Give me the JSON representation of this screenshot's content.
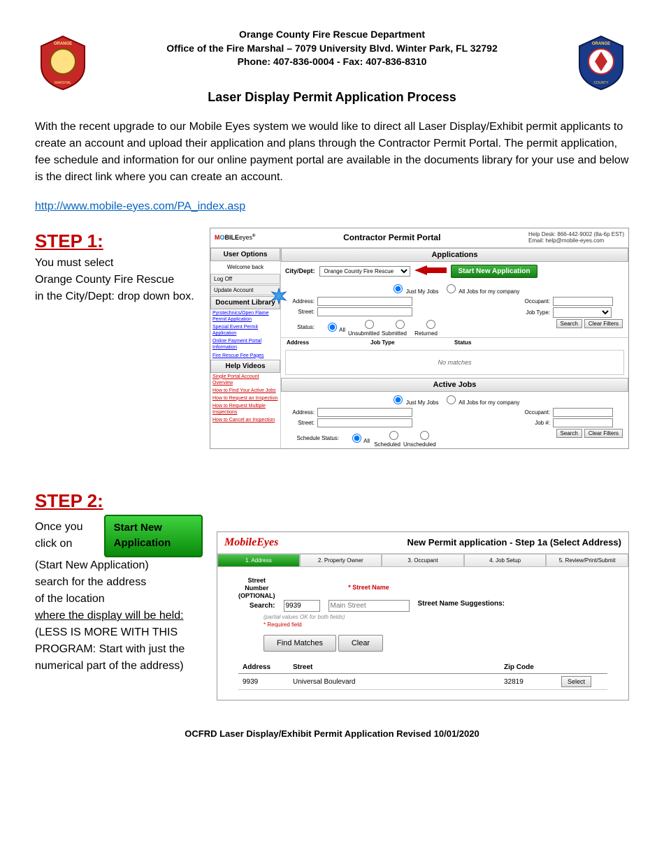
{
  "header": {
    "l1": "Orange County Fire Rescue Department",
    "l2": "Office of the Fire Marshal – 7079 University Blvd. Winter Park, FL 32792",
    "l3": "Phone:  407-836-0004 - Fax: 407-836-8310"
  },
  "title": "Laser Display Permit Application Process",
  "intro": "With the recent upgrade to our Mobile Eyes system we would like to direct all Laser Display/Exhibit permit applicants to create an account and upload their application and plans through the Contractor Permit Portal. The permit application, fee schedule and information for our online payment portal are available in the documents library for your use and below is the direct link where you can create an account.",
  "link": "http://www.mobile-eyes.com/PA_index.asp",
  "step1": {
    "heading": "STEP 1:",
    "l1": "You must select",
    "l2": "Orange County Fire Rescue",
    "l3": "in the City/Dept: drop down box."
  },
  "shot1": {
    "logo": "MOBILEeyes",
    "portal_title": "Contractor Permit Portal",
    "help_l1": "Help Desk: 866-442-9002 (8a-6p EST)",
    "help_l2": "Email: help@mobile-eyes.com",
    "sidebar": {
      "user_options": "User Options",
      "welcome": "Welcome back",
      "logoff": "Log Off",
      "update": "Update Account",
      "doc_lib": "Document Library",
      "docs": [
        "Pyrotechnics/Open Flame Permit Application",
        "Special Event Permit Application",
        "Online Payment Portal Information",
        "Fire Rescue Fee Pages"
      ],
      "help_videos": "Help Videos",
      "videos": [
        "Single Portal Account Overview",
        "How to Find Your Active Jobs",
        "How to Request an Inspection",
        "How to Request Multiple Inspections",
        "How to Cancel an Inspection"
      ]
    },
    "applications": {
      "hdr": "Applications",
      "city_label": "City/Dept:",
      "city_value": "Orange County Fire Rescue",
      "start_btn": "Start New Application",
      "just_my": "Just My Jobs",
      "all_jobs": "All Jobs for my company",
      "address": "Address:",
      "street": "Street:",
      "status": "Status:",
      "all": "All",
      "unsub": "Unsubmitted",
      "sub": "Submitted",
      "ret": "Returned",
      "occupant": "Occupant:",
      "jobtype": "Job Type:",
      "search": "Search",
      "clear": "Clear Filters",
      "th_addr": "Address",
      "th_jt": "Job Type",
      "th_status": "Status",
      "nomatch": "No matches"
    },
    "active": {
      "hdr": "Active Jobs",
      "just_my": "Just My Jobs",
      "all_jobs": "All Jobs for my company",
      "address": "Address:",
      "street": "Street:",
      "sched": "Schedule Status:",
      "all": "All",
      "scheduled": "Scheduled",
      "unscheduled": "Unscheduled",
      "occupant": "Occupant:",
      "jobid": "Job #:",
      "search": "Search",
      "clear": "Clear Filters"
    }
  },
  "step2": {
    "heading": "STEP 2:",
    "btn": "Start New Application",
    "l1": "Once you click on",
    "l2": "(Start New Application)",
    "l3": "search for the address",
    "l4": "of the location",
    "l5": "where the display will be held:",
    "l6": "(LESS IS MORE WITH THIS",
    "l7": "PROGRAM: Start with just the",
    "l8": "numerical part of the address)"
  },
  "shot2": {
    "logo": "MobileEyes",
    "title": "New Permit application - Step 1a (Select Address)",
    "tabs": [
      "1. Address",
      "2. Property Owner",
      "3. Occupant",
      "4. Job Setup",
      "5. Review/Print/Submit"
    ],
    "col1": "Street\nNumber\n(OPTIONAL)",
    "col2": "* Street Name",
    "sugg": "Street Name Suggestions:",
    "search_lbl": "Search:",
    "num": "9939",
    "street_ph": "Main Street",
    "hint": "(partial values OK for both fields)",
    "req": "* Required field",
    "find": "Find Matches",
    "clear": "Clear",
    "th_addr": "Address",
    "th_street": "Street",
    "th_zip": "Zip Code",
    "row_addr": "9939",
    "row_street": "Universal Boulevard",
    "row_zip": "32819",
    "select": "Select"
  },
  "footer": "OCFRD Laser Display/Exhibit Permit Application Revised 10/01/2020"
}
